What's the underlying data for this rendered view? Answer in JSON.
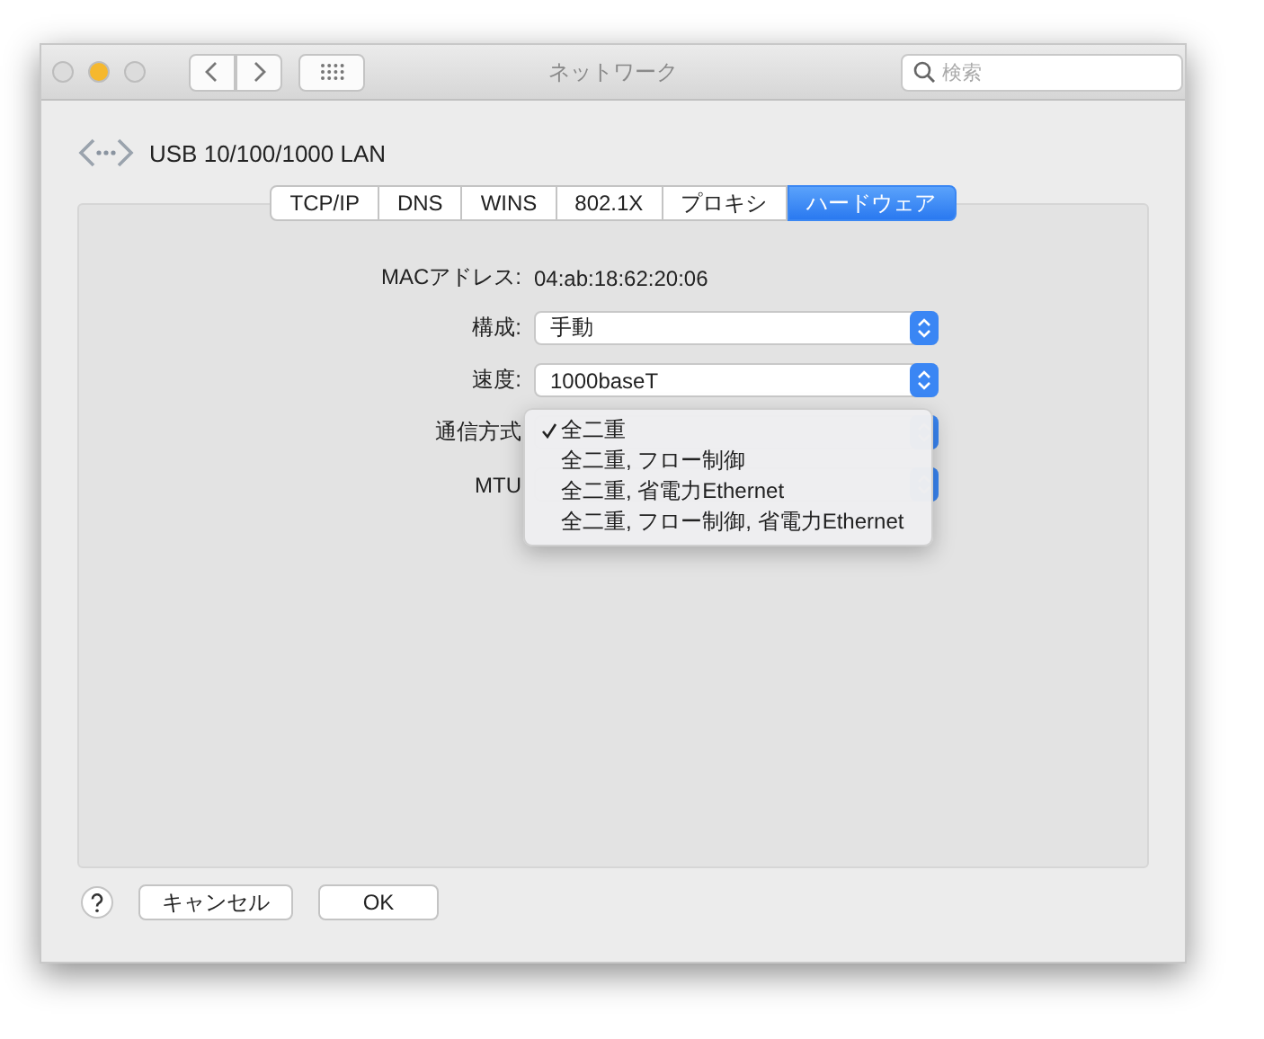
{
  "window": {
    "title": "ネットワーク"
  },
  "search": {
    "placeholder": "検索"
  },
  "interface": {
    "name": "USB 10/100/1000 LAN"
  },
  "tabs": [
    {
      "label": "TCP/IP",
      "selected": false
    },
    {
      "label": "DNS",
      "selected": false
    },
    {
      "label": "WINS",
      "selected": false
    },
    {
      "label": "802.1X",
      "selected": false
    },
    {
      "label": "プロキシ",
      "selected": false
    },
    {
      "label": "ハードウェア",
      "selected": true
    }
  ],
  "fields": [
    {
      "kind": "text",
      "label": "MACアドレス:",
      "value": "04:ab:18:62:20:06"
    },
    {
      "kind": "popup",
      "label": "構成:",
      "value": "手動"
    },
    {
      "kind": "popup",
      "label": "速度:",
      "value": "1000baseT"
    },
    {
      "kind": "popup",
      "label": "通信方式"
    },
    {
      "kind": "popup",
      "label": "MTU"
    }
  ],
  "menu": {
    "items": [
      {
        "label": "全二重",
        "checked": true
      },
      {
        "label": "全二重, フロー制御",
        "checked": false
      },
      {
        "label": "全二重, 省電力Ethernet",
        "checked": false
      },
      {
        "label": "全二重, フロー制御, 省電力Ethernet",
        "checked": false
      }
    ]
  },
  "buttons": [
    {
      "label": "キャンセル"
    },
    {
      "label": "OK"
    }
  ]
}
